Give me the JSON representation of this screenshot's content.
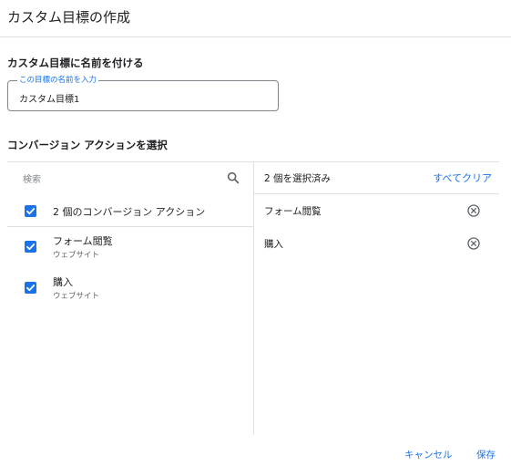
{
  "dialog": {
    "title": "カスタム目標の作成"
  },
  "name_section": {
    "label": "カスタム目標に名前を付ける",
    "field_label": "この目標の名前を入力",
    "field_value": "カスタム目標1"
  },
  "conversion_section": {
    "label": "コンバージョン アクションを選択",
    "search_placeholder": "検索",
    "select_all_label": "2 個のコンバージョン アクション",
    "items": [
      {
        "name": "フォーム閲覧",
        "type": "ウェブサイト",
        "checked": true
      },
      {
        "name": "購入",
        "type": "ウェブサイト",
        "checked": true
      }
    ],
    "selected_count": "2 個を選択済み",
    "clear_all": "すべてクリア",
    "selected_items": [
      {
        "name": "フォーム閲覧"
      },
      {
        "name": "購入"
      }
    ]
  },
  "footer": {
    "cancel": "キャンセル",
    "save": "保存"
  },
  "colors": {
    "accent": "#1a73e8",
    "divider": "#e0e0e0",
    "text": "#202124",
    "secondary_text": "#5f6368"
  },
  "icons": {
    "search": "search-icon",
    "checkbox": "checkbox-checked-icon",
    "remove": "close-circle-icon"
  }
}
